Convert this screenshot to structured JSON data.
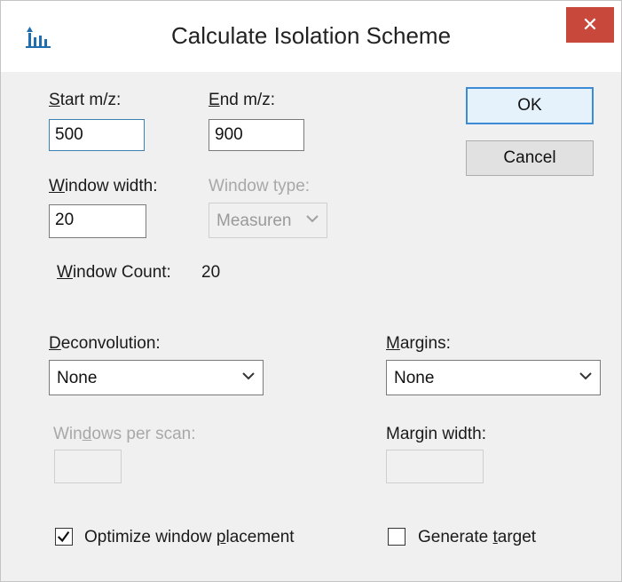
{
  "window": {
    "title": "Calculate Isolation Scheme",
    "close_label": "✕"
  },
  "form": {
    "start_mz": {
      "label_key": "S",
      "label_rest": "tart m/z:",
      "value": "500"
    },
    "end_mz": {
      "label_key": "E",
      "label_rest": "nd m/z:",
      "value": "900"
    },
    "window_width": {
      "label_key": "W",
      "label_rest": "indow width:",
      "value": "20"
    },
    "window_type": {
      "label": "Window type:",
      "value": "Measuren"
    },
    "window_count": {
      "label_key": "W",
      "label_rest": "indow Count:",
      "value": "20"
    },
    "deconvolution": {
      "label_key": "D",
      "label_rest": "econvolution:",
      "value": "None"
    },
    "margins": {
      "label_key": "M",
      "label_rest": "argins:",
      "value": "None"
    },
    "windows_per_scan": {
      "label_pre": "Win",
      "label_key": "d",
      "label_rest": "ows per scan:",
      "value": ""
    },
    "margin_width": {
      "label": "Margin width:",
      "value": ""
    },
    "optimize": {
      "label_pre": "Optimize window ",
      "label_key": "p",
      "label_rest": "lacement",
      "checked": true
    },
    "generate_target": {
      "label_pre": "Generate ",
      "label_key": "t",
      "label_rest": "arget",
      "checked": false
    }
  },
  "buttons": {
    "ok": "OK",
    "cancel": "Cancel"
  },
  "colors": {
    "accent": "#3c8bd6",
    "close": "#c9483c",
    "icon": "#1f6fb0"
  },
  "icons": {
    "app": "chart-icon",
    "dropdown": "chevron-down-icon",
    "check": "checkmark-icon"
  }
}
